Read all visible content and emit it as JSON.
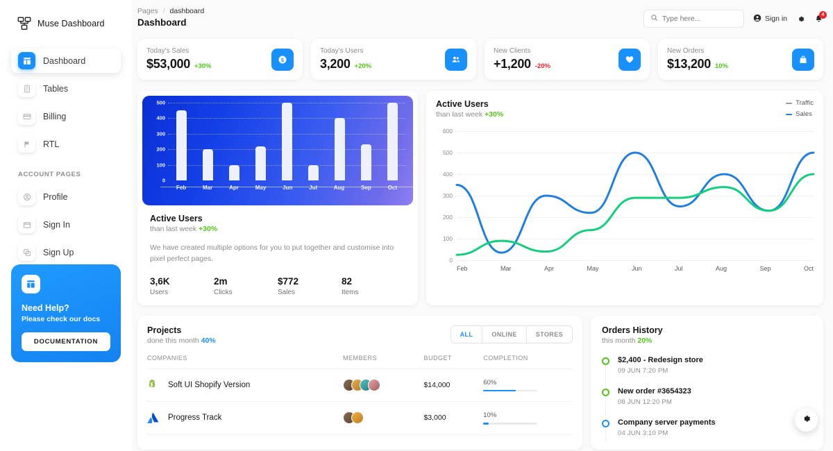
{
  "brand": {
    "label": "Muse Dashboard",
    "logo_icon": "muse-logo-icon"
  },
  "sidebar": {
    "items": [
      {
        "label": "Dashboard",
        "icon": "dashboard-icon",
        "active": true
      },
      {
        "label": "Tables",
        "icon": "tables-icon",
        "active": false
      },
      {
        "label": "Billing",
        "icon": "billing-icon",
        "active": false
      },
      {
        "label": "RTL",
        "icon": "flag-icon",
        "active": false
      }
    ],
    "section_label": "ACCOUNT PAGES",
    "account_items": [
      {
        "label": "Profile",
        "icon": "profile-icon"
      },
      {
        "label": "Sign In",
        "icon": "sign-in-icon"
      },
      {
        "label": "Sign Up",
        "icon": "sign-up-icon"
      }
    ],
    "help_card": {
      "icon": "help-logo-icon",
      "title": "Need Help?",
      "subtitle": "Please check our docs",
      "button_label": "DOCUMENTATION"
    }
  },
  "header": {
    "breadcrumb_root": "Pages",
    "breadcrumb_sep": "/",
    "breadcrumb_current": "dashboard",
    "title": "Dashboard",
    "search_placeholder": "Type here...",
    "search_value": "",
    "search_icon": "search-icon",
    "signin_label": "Sign in",
    "signin_icon": "user-icon",
    "settings_icon": "gear-icon",
    "bell_icon": "bell-icon",
    "notification_count": "4"
  },
  "stats": [
    {
      "label": "Today's Sales",
      "value": "$53,000",
      "delta": "+30%",
      "direction": "up",
      "icon": "dollar-icon"
    },
    {
      "label": "Today's Users",
      "value": "3,200",
      "delta": "+20%",
      "direction": "up",
      "icon": "users-icon"
    },
    {
      "label": "New Clients",
      "value": "+1,200",
      "delta": "-20%",
      "direction": "down",
      "icon": "heart-icon"
    },
    {
      "label": "New Orders",
      "value": "$13,200",
      "delta": "10%",
      "direction": "up",
      "icon": "bag-icon"
    }
  ],
  "active_users_block": {
    "title": "Active Users",
    "subtitle_text": "than last week",
    "subtitle_delta": "+30%",
    "description": "We have created multiple options for you to put together and customise into pixel perfect pages.",
    "mini_stats": [
      {
        "value": "3,6K",
        "label": "Users"
      },
      {
        "value": "2m",
        "label": "Clicks"
      },
      {
        "value": "$772",
        "label": "Sales"
      },
      {
        "value": "82",
        "label": "Items"
      }
    ]
  },
  "line_card": {
    "title": "Active Users",
    "subtitle_text": "than last week",
    "subtitle_delta": "+30%"
  },
  "projects": {
    "title": "Projects",
    "subtitle_text": "done this month",
    "subtitle_accent": "40%",
    "tabs": [
      {
        "label": "ALL",
        "active": true
      },
      {
        "label": "ONLINE",
        "active": false
      },
      {
        "label": "STORES",
        "active": false
      }
    ],
    "columns": [
      "COMPANIES",
      "MEMBERS",
      "BUDGET",
      "COMPLETION"
    ],
    "rows": [
      {
        "company": "Soft UI Shopify Version",
        "logo": "shopify-icon",
        "members": 4,
        "budget": "$14,000",
        "completion_label": "60%",
        "completion": 60
      },
      {
        "company": "Progress Track",
        "logo": "atlassian-icon",
        "members": 2,
        "budget": "$3,000",
        "completion_label": "10%",
        "completion": 10
      }
    ]
  },
  "orders_history": {
    "title": "Orders History",
    "subtitle_text": "this month",
    "subtitle_delta": "20%",
    "items": [
      {
        "title": "$2,400 - Redesign store",
        "time": "09 JUN 7:20 PM",
        "color": "green"
      },
      {
        "title": "New order #3654323",
        "time": "08 JUN 12:20 PM",
        "color": "green"
      },
      {
        "title": "Company server payments",
        "time": "04 JUN 3:10 PM",
        "color": "blue"
      }
    ]
  },
  "fab": {
    "icon": "gear-icon"
  },
  "colors": {
    "accent": "#1890ff",
    "success": "#52c41a",
    "danger": "#f5222d",
    "traffic_line": "#1f7fe0",
    "sales_line": "#12cf7e",
    "chart_gradient_start": "#0b2fd6",
    "chart_gradient_end": "#8f7ef2"
  },
  "chart_data": [
    {
      "type": "bar",
      "title": "Active Users",
      "categories": [
        "Feb",
        "Mar",
        "Apr",
        "May",
        "Jun",
        "Jul",
        "Aug",
        "Sep",
        "Oct"
      ],
      "values": [
        450,
        200,
        100,
        220,
        500,
        100,
        400,
        230,
        500
      ],
      "ylim": [
        0,
        500
      ],
      "yticks": [
        0,
        100,
        200,
        300,
        400,
        500
      ],
      "xlabel": "",
      "ylabel": "",
      "grid": true,
      "legend": "none"
    },
    {
      "type": "line",
      "title": "Active Users",
      "x": [
        "Feb",
        "Mar",
        "Apr",
        "May",
        "Jun",
        "Jul",
        "Aug",
        "Sep",
        "Oct"
      ],
      "series": [
        {
          "name": "Traffic",
          "values": [
            350,
            35,
            300,
            220,
            500,
            250,
            400,
            230,
            500
          ],
          "color": "#1f7fe0"
        },
        {
          "name": "Sales",
          "values": [
            25,
            90,
            40,
            140,
            290,
            290,
            340,
            230,
            400
          ],
          "color": "#12cf7e"
        }
      ],
      "ylim": [
        0,
        600
      ],
      "yticks": [
        0,
        100,
        200,
        300,
        400,
        500,
        600
      ],
      "xlabel": "",
      "ylabel": "",
      "grid": true,
      "legend": "top-right"
    }
  ]
}
